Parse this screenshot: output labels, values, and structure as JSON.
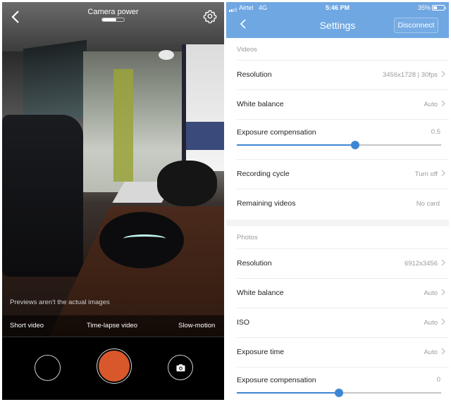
{
  "camera": {
    "title": "Camera power",
    "power_level": 0.65,
    "back_icon": "chevron-left-icon",
    "settings_icon": "gear-icon",
    "preview_note": "Previews aren't the actual images",
    "modes": [
      "Short video",
      "Time-lapse video",
      "Slow-motion"
    ],
    "controls": {
      "gallery": "gallery-thumbnail",
      "record": "record-button",
      "photo": "camera-icon"
    },
    "colors": {
      "record": "#d9582b"
    }
  },
  "status_bar": {
    "carrier": "Airtel",
    "network": "4G",
    "time": "5:46 PM",
    "battery": "35%",
    "battery_level": 0.35
  },
  "settings": {
    "title": "Settings",
    "back_icon": "chevron-left-icon",
    "disconnect_label": "Disconnect",
    "accent": "#6fa7e2",
    "videos": {
      "header": "Videos",
      "rows": [
        {
          "label": "Resolution",
          "value": "3456x1728 | 30fps"
        },
        {
          "label": "White balance",
          "value": "Auto"
        }
      ],
      "exposure": {
        "label": "Exposure compensation",
        "value": "0.5",
        "position": 0.58
      },
      "rows2": [
        {
          "label": "Recording cycle",
          "value": "Turn off"
        },
        {
          "label": "Remaining videos",
          "value": "No card"
        }
      ]
    },
    "photos": {
      "header": "Photos",
      "rows": [
        {
          "label": "Resolution",
          "value": "6912x3456"
        },
        {
          "label": "White balance",
          "value": "Auto"
        },
        {
          "label": "ISO",
          "value": "Auto"
        },
        {
          "label": "Exposure time",
          "value": "Auto"
        }
      ],
      "exposure": {
        "label": "Exposure compensation",
        "value": "0",
        "position": 0.5
      }
    }
  }
}
